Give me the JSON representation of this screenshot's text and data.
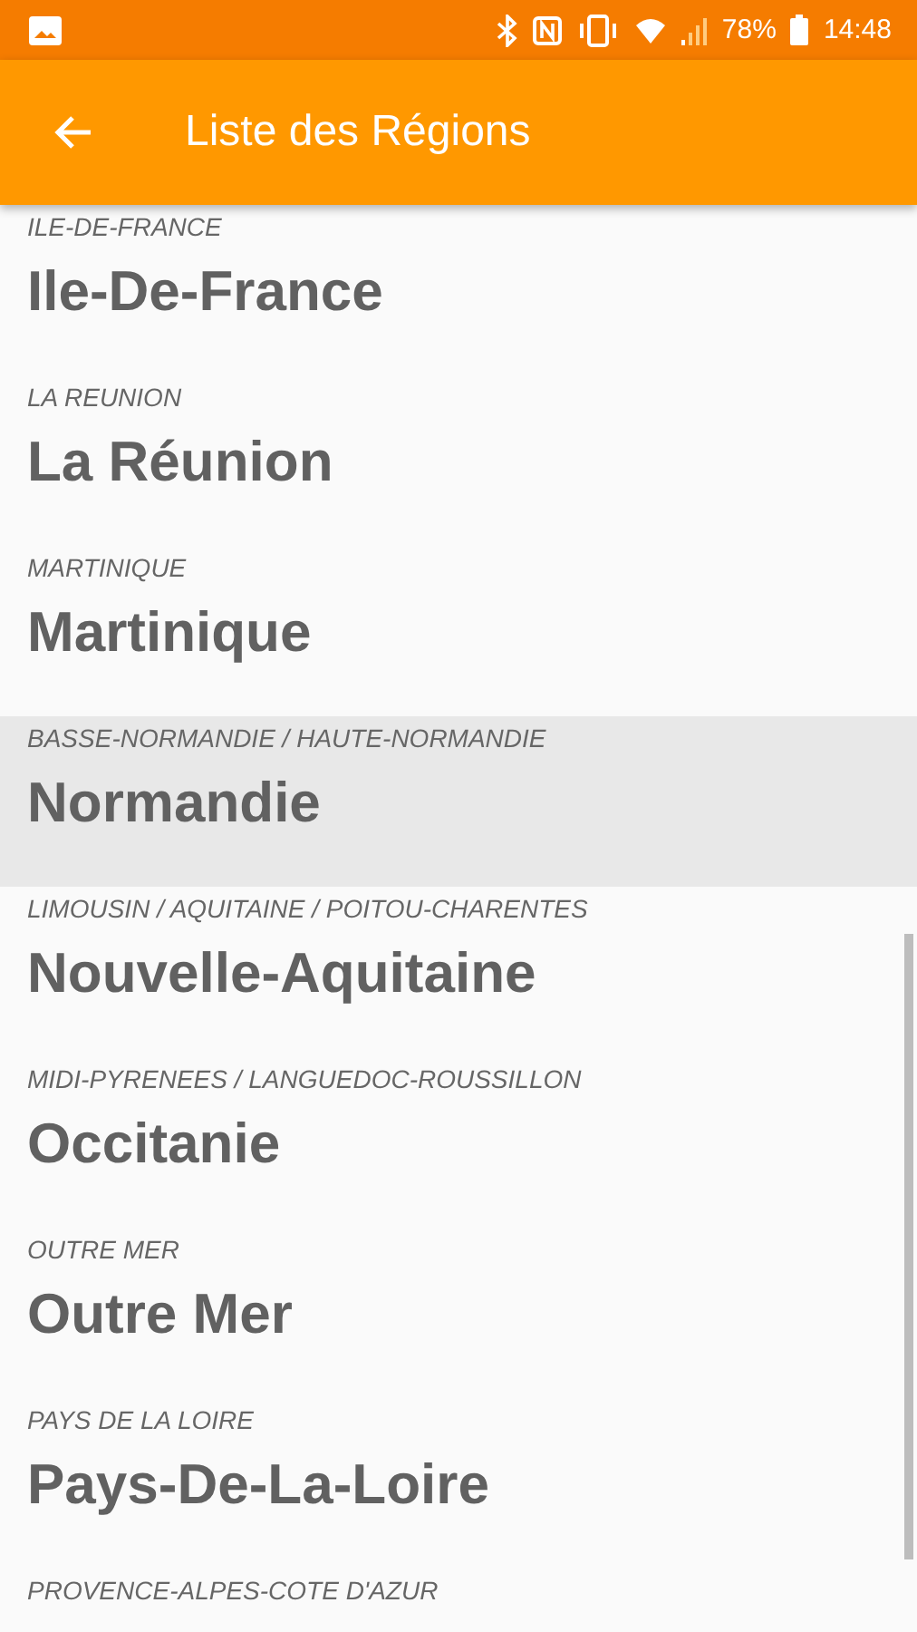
{
  "status_bar": {
    "battery": "78%",
    "time": "14:48"
  },
  "app_bar": {
    "title": "Liste des Régions"
  },
  "regions": [
    {
      "subtitle": "ILE-DE-FRANCE",
      "name": "Ile-De-France",
      "selected": false
    },
    {
      "subtitle": "LA REUNION",
      "name": "La Réunion",
      "selected": false
    },
    {
      "subtitle": "MARTINIQUE",
      "name": "Martinique",
      "selected": false
    },
    {
      "subtitle": "BASSE-NORMANDIE / HAUTE-NORMANDIE",
      "name": "Normandie",
      "selected": true
    },
    {
      "subtitle": "LIMOUSIN / AQUITAINE / POITOU-CHARENTES",
      "name": "Nouvelle-Aquitaine",
      "selected": false
    },
    {
      "subtitle": "MIDI-PYRENEES / LANGUEDOC-ROUSSILLON",
      "name": "Occitanie",
      "selected": false
    },
    {
      "subtitle": "OUTRE MER",
      "name": "Outre Mer",
      "selected": false
    },
    {
      "subtitle": "PAYS DE LA LOIRE",
      "name": "Pays-De-La-Loire",
      "selected": false
    },
    {
      "subtitle": "PROVENCE-ALPES-COTE D'AZUR",
      "selected": false
    }
  ]
}
